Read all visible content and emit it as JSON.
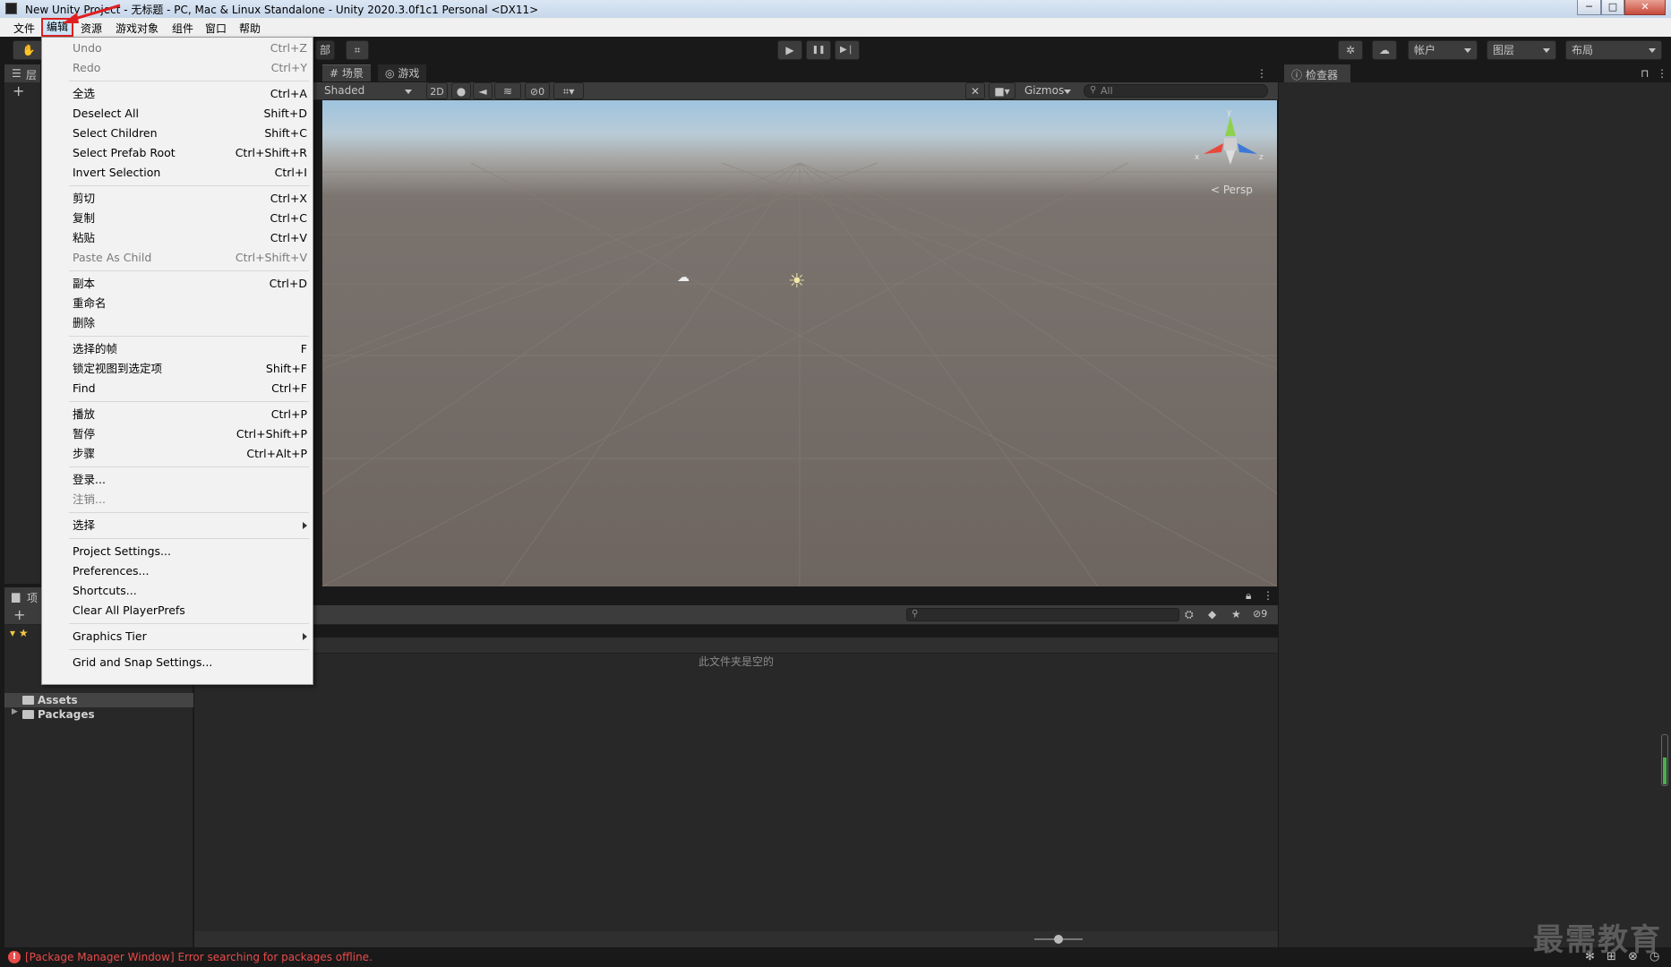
{
  "window": {
    "title": "New Unity Project - 无标题 - PC, Mac & Linux Standalone - Unity 2020.3.0f1c1 Personal <DX11>",
    "controls": {
      "minimize": "─",
      "maximize": "□",
      "close": "✕"
    }
  },
  "menubar": {
    "items": [
      "文件",
      "编辑",
      "资源",
      "游戏对象",
      "组件",
      "窗口",
      "帮助"
    ]
  },
  "toolbar": {
    "hierarchy_tab_fragment": "部",
    "play": "▶",
    "pause": "❚❚",
    "step": "▶❘",
    "account_label": "帐户",
    "layers_label": "图层",
    "layout_label": "布局"
  },
  "scene": {
    "tab_scene": "场景",
    "tab_game": "游戏",
    "shading_mode": "Shaded",
    "toggle_2d": "2D",
    "hidden_count": "0",
    "gizmos_label": "Gizmos",
    "search_placeholder": "All",
    "persp_label": "< Persp",
    "gizmo_axes": {
      "x": "x",
      "y": "y",
      "z": "z"
    }
  },
  "hierarchy": {
    "tab_fragment": "层",
    "add_button": "+"
  },
  "project": {
    "tab_fragment": "项",
    "add_button": "+",
    "tree": [
      "Assets",
      "Packages"
    ],
    "empty_message": "此文件夹是空的",
    "hidden_packages_count": "9"
  },
  "inspector": {
    "tab_label": "检查器"
  },
  "status": {
    "message": "[Package Manager Window] Error searching for packages offline."
  },
  "watermark": "最需教育",
  "edit_menu": {
    "items": [
      {
        "label": "Undo",
        "shortcut": "Ctrl+Z",
        "disabled": true
      },
      {
        "label": "Redo",
        "shortcut": "Ctrl+Y",
        "disabled": true
      },
      {
        "label": "全选",
        "shortcut": "Ctrl+A"
      },
      {
        "label": "Deselect All",
        "shortcut": "Shift+D"
      },
      {
        "label": "Select Children",
        "shortcut": "Shift+C"
      },
      {
        "label": "Select Prefab Root",
        "shortcut": "Ctrl+Shift+R"
      },
      {
        "label": "Invert Selection",
        "shortcut": "Ctrl+I"
      },
      {
        "label": "剪切",
        "shortcut": "Ctrl+X"
      },
      {
        "label": "复制",
        "shortcut": "Ctrl+C"
      },
      {
        "label": "粘贴",
        "shortcut": "Ctrl+V"
      },
      {
        "label": "Paste As Child",
        "shortcut": "Ctrl+Shift+V",
        "disabled": true
      },
      {
        "label": "副本",
        "shortcut": "Ctrl+D"
      },
      {
        "label": "重命名",
        "shortcut": ""
      },
      {
        "label": "删除",
        "shortcut": ""
      },
      {
        "label": "选择的帧",
        "shortcut": "F"
      },
      {
        "label": "锁定视图到选定项",
        "shortcut": "Shift+F"
      },
      {
        "label": "Find",
        "shortcut": "Ctrl+F"
      },
      {
        "label": "播放",
        "shortcut": "Ctrl+P"
      },
      {
        "label": "暂停",
        "shortcut": "Ctrl+Shift+P"
      },
      {
        "label": "步骤",
        "shortcut": "Ctrl+Alt+P"
      },
      {
        "label": "登录...",
        "shortcut": ""
      },
      {
        "label": "注销...",
        "shortcut": "",
        "disabled": true
      },
      {
        "label": "选择",
        "shortcut": "",
        "submenu": true
      },
      {
        "label": "Project Settings...",
        "shortcut": ""
      },
      {
        "label": "Preferences...",
        "shortcut": ""
      },
      {
        "label": "Shortcuts...",
        "shortcut": ""
      },
      {
        "label": "Clear All PlayerPrefs",
        "shortcut": ""
      },
      {
        "label": "Graphics Tier",
        "shortcut": "",
        "submenu": true
      },
      {
        "label": "Grid and Snap Settings...",
        "shortcut": ""
      }
    ]
  }
}
